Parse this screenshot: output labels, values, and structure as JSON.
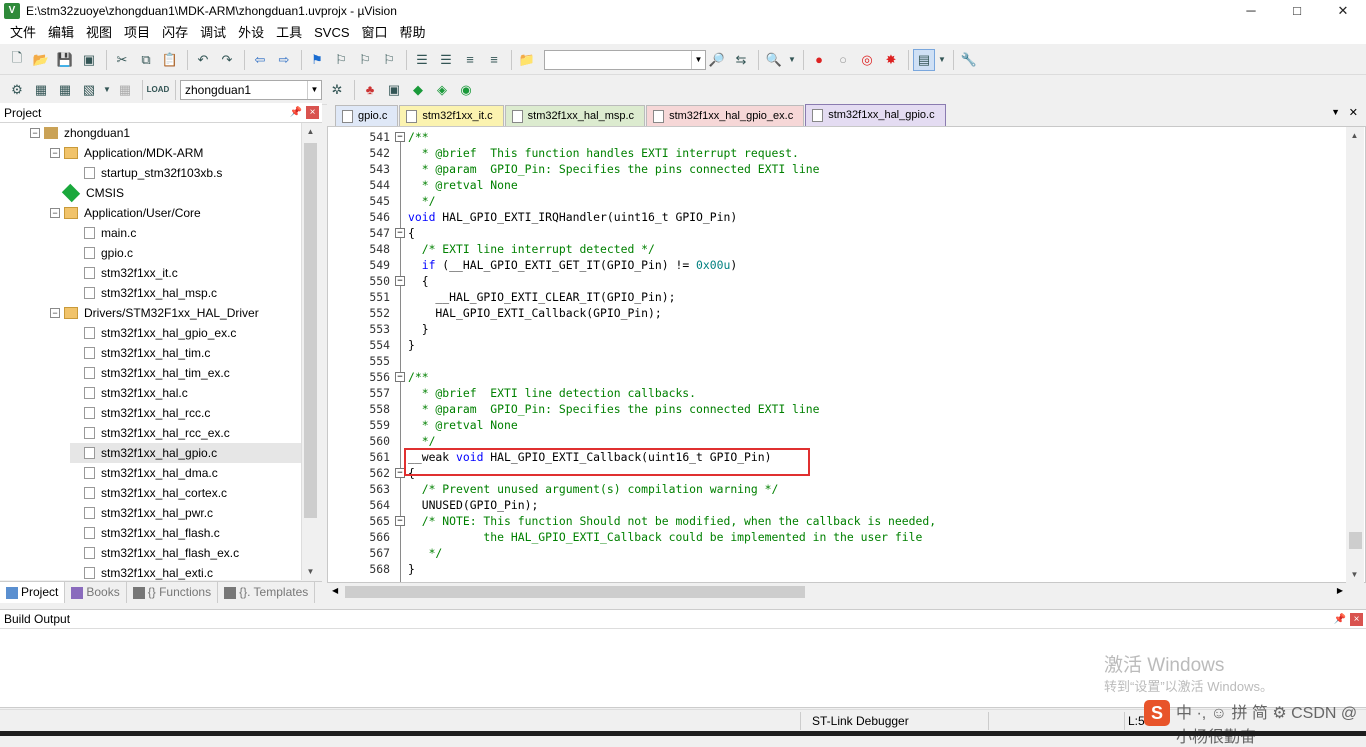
{
  "window": {
    "title": "E:\\stm32zuoye\\zhongduan1\\MDK-ARM\\zhongduan1.uvprojx - µVision",
    "min": "─",
    "max": "□",
    "close": "✕"
  },
  "menu": [
    "文件",
    "编辑",
    "视图",
    "项目",
    "闪存",
    "调试",
    "外设",
    "工具",
    "SVCS",
    "窗口",
    "帮助"
  ],
  "toolbar2": {
    "target": "zhongduan1"
  },
  "project_panel": {
    "title": "Project",
    "pin": "📌",
    "close": "×"
  },
  "tree": [
    {
      "label": "zhongduan1",
      "level": 0,
      "type": "project",
      "expanded": true
    },
    {
      "label": "Application/MDK-ARM",
      "level": 1,
      "type": "folder",
      "expanded": true
    },
    {
      "label": "startup_stm32f103xb.s",
      "level": 2,
      "type": "file"
    },
    {
      "label": "CMSIS",
      "level": 1,
      "type": "gem"
    },
    {
      "label": "Application/User/Core",
      "level": 1,
      "type": "folder",
      "expanded": true
    },
    {
      "label": "main.c",
      "level": 2,
      "type": "file"
    },
    {
      "label": "gpio.c",
      "level": 2,
      "type": "file"
    },
    {
      "label": "stm32f1xx_it.c",
      "level": 2,
      "type": "file"
    },
    {
      "label": "stm32f1xx_hal_msp.c",
      "level": 2,
      "type": "file"
    },
    {
      "label": "Drivers/STM32F1xx_HAL_Driver",
      "level": 1,
      "type": "folder",
      "expanded": true
    },
    {
      "label": "stm32f1xx_hal_gpio_ex.c",
      "level": 2,
      "type": "file"
    },
    {
      "label": "stm32f1xx_hal_tim.c",
      "level": 2,
      "type": "file"
    },
    {
      "label": "stm32f1xx_hal_tim_ex.c",
      "level": 2,
      "type": "file"
    },
    {
      "label": "stm32f1xx_hal.c",
      "level": 2,
      "type": "file"
    },
    {
      "label": "stm32f1xx_hal_rcc.c",
      "level": 2,
      "type": "file"
    },
    {
      "label": "stm32f1xx_hal_rcc_ex.c",
      "level": 2,
      "type": "file"
    },
    {
      "label": "stm32f1xx_hal_gpio.c",
      "level": 2,
      "type": "file",
      "selected": true
    },
    {
      "label": "stm32f1xx_hal_dma.c",
      "level": 2,
      "type": "file"
    },
    {
      "label": "stm32f1xx_hal_cortex.c",
      "level": 2,
      "type": "file"
    },
    {
      "label": "stm32f1xx_hal_pwr.c",
      "level": 2,
      "type": "file"
    },
    {
      "label": "stm32f1xx_hal_flash.c",
      "level": 2,
      "type": "file"
    },
    {
      "label": "stm32f1xx_hal_flash_ex.c",
      "level": 2,
      "type": "file"
    },
    {
      "label": "stm32f1xx_hal_exti.c",
      "level": 2,
      "type": "file"
    }
  ],
  "project_tabs": [
    {
      "label": "Project",
      "color": "#5a8fd0",
      "active": true
    },
    {
      "label": "Books",
      "color": "#8a6bbd",
      "active": false
    },
    {
      "label": "{} Functions",
      "color": "#777",
      "active": false
    },
    {
      "label": "{}. Templates",
      "color": "#777",
      "active": false
    }
  ],
  "editor_tabs": [
    {
      "label": "gpio.c",
      "color": "#dfe8f7",
      "active": false
    },
    {
      "label": "stm32f1xx_it.c",
      "color": "#fbf3b0",
      "active": false
    },
    {
      "label": "stm32f1xx_hal_msp.c",
      "color": "#dcebcf",
      "active": false
    },
    {
      "label": "stm32f1xx_hal_gpio_ex.c",
      "color": "#f6d7d7",
      "active": false
    },
    {
      "label": "stm32f1xx_hal_gpio.c",
      "color": "#e4dcf2",
      "active": true
    }
  ],
  "code": [
    {
      "n": "541",
      "fold": "minus",
      "segs": [
        [
          "/**",
          "cm"
        ]
      ]
    },
    {
      "n": "542",
      "segs": [
        [
          "  * @brief  This function handles EXTI interrupt request.",
          "cm"
        ]
      ]
    },
    {
      "n": "543",
      "segs": [
        [
          "  * @param  GPIO_Pin: Specifies the pins connected EXTI line",
          "cm"
        ]
      ]
    },
    {
      "n": "544",
      "segs": [
        [
          "  * @retval None",
          "cm"
        ]
      ]
    },
    {
      "n": "545",
      "segs": [
        [
          "  */",
          "cm"
        ]
      ]
    },
    {
      "n": "546",
      "segs": [
        [
          "void",
          "kw"
        ],
        [
          " HAL_GPIO_EXTI_IRQHandler(uint16_t GPIO_Pin)",
          ""
        ]
      ]
    },
    {
      "n": "547",
      "fold": "minus",
      "segs": [
        [
          "{",
          ""
        ]
      ]
    },
    {
      "n": "548",
      "segs": [
        [
          "  /* EXTI line interrupt detected */",
          "cm"
        ]
      ]
    },
    {
      "n": "549",
      "segs": [
        [
          "  ",
          ""
        ],
        [
          "if",
          "kw"
        ],
        [
          " (__HAL_GPIO_EXTI_GET_IT(GPIO_Pin) != ",
          ""
        ],
        [
          "0x00u",
          "nm"
        ],
        [
          ")",
          ""
        ]
      ]
    },
    {
      "n": "550",
      "fold": "minus",
      "segs": [
        [
          "  {",
          ""
        ]
      ]
    },
    {
      "n": "551",
      "segs": [
        [
          "    __HAL_GPIO_EXTI_CLEAR_IT(GPIO_Pin);",
          ""
        ]
      ]
    },
    {
      "n": "552",
      "segs": [
        [
          "    HAL_GPIO_EXTI_Callback(GPIO_Pin);",
          ""
        ]
      ]
    },
    {
      "n": "553",
      "segs": [
        [
          "  }",
          ""
        ]
      ]
    },
    {
      "n": "554",
      "segs": [
        [
          "}",
          ""
        ]
      ]
    },
    {
      "n": "555",
      "segs": [
        [
          "",
          ""
        ]
      ]
    },
    {
      "n": "556",
      "fold": "minus",
      "segs": [
        [
          "/**",
          "cm"
        ]
      ]
    },
    {
      "n": "557",
      "segs": [
        [
          "  * @brief  EXTI line detection callbacks.",
          "cm"
        ]
      ]
    },
    {
      "n": "558",
      "segs": [
        [
          "  * @param  GPIO_Pin: Specifies the pins connected EXTI line",
          "cm"
        ]
      ]
    },
    {
      "n": "559",
      "segs": [
        [
          "  * @retval None",
          "cm"
        ]
      ]
    },
    {
      "n": "560",
      "segs": [
        [
          "  */",
          "cm"
        ]
      ]
    },
    {
      "n": "561",
      "segs": [
        [
          "__weak ",
          ""
        ],
        [
          "void",
          "kw"
        ],
        [
          " HAL_GPIO_EXTI_Callback(uint16_t GPIO_Pin)",
          ""
        ]
      ]
    },
    {
      "n": "562",
      "fold": "minus",
      "segs": [
        [
          "{",
          ""
        ]
      ]
    },
    {
      "n": "563",
      "segs": [
        [
          "  /* Prevent unused argument(s) compilation warning */",
          "cm"
        ]
      ]
    },
    {
      "n": "564",
      "segs": [
        [
          "  UNUSED(GPIO_Pin);",
          ""
        ]
      ]
    },
    {
      "n": "565",
      "fold": "minus",
      "segs": [
        [
          "  /* NOTE: This function Should not be modified, when the callback is needed,",
          "cm"
        ]
      ]
    },
    {
      "n": "566",
      "segs": [
        [
          "           the HAL_GPIO_EXTI_Callback could be implemented in the user file",
          "cm"
        ]
      ]
    },
    {
      "n": "567",
      "segs": [
        [
          "   */",
          "cm"
        ]
      ]
    },
    {
      "n": "568",
      "segs": [
        [
          "}",
          ""
        ]
      ]
    }
  ],
  "build_output": {
    "title": "Build Output"
  },
  "watermark": {
    "line1": "激活 Windows",
    "line2": "转到“设置”以激活 Windows。"
  },
  "status": {
    "debugger": "ST-Link Debugger",
    "loc": "L:5",
    "csdn": "中 ·, ☺ 拼 简 ⚙  CSDN @小杨很勤奋"
  }
}
